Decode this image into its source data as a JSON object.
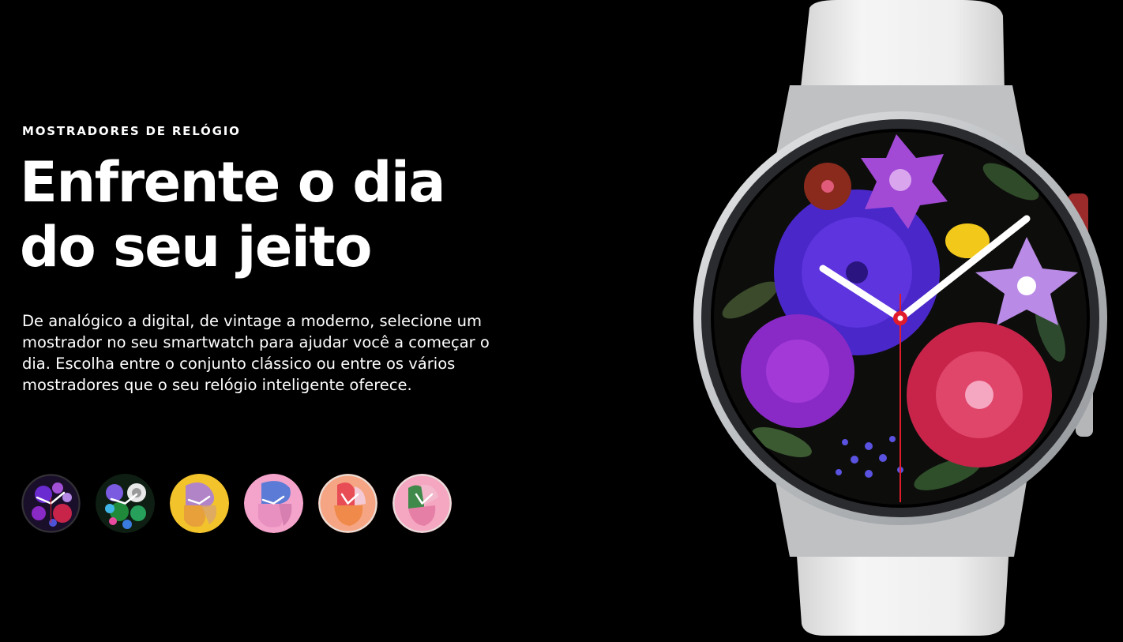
{
  "section": {
    "eyebrow": "MOSTRADORES DE RELÓGIO",
    "headline_line1": "Enfrente o dia",
    "headline_line2": "do seu jeito",
    "description": "De analógico a digital, de vintage a moderno, selecione um mostrador no seu smartwatch para ajudar você a começar o dia. Escolha entre o conjunto clássico ou entre os vários mostradores que o seu relógio inteligente oferece."
  },
  "thumbnails": [
    {
      "icon": "floral-purple-watchface-icon",
      "bg": "#1a0f2a",
      "accent": "#7a2fd0"
    },
    {
      "icon": "floral-green-watchface-icon",
      "bg": "#0e1e12",
      "accent": "#1f8a3a"
    },
    {
      "icon": "yellow-shapes-watchface-icon",
      "bg": "#f3c32c",
      "accent": "#e7a03a"
    },
    {
      "icon": "pink-blue-shapes-watchface-icon",
      "bg": "#f4a3cb",
      "accent": "#5b7bd6"
    },
    {
      "icon": "coral-shapes-watchface-icon",
      "bg": "#f28a6c",
      "accent": "#e84c55"
    },
    {
      "icon": "pink-green-shapes-watchface-icon",
      "bg": "#f5a6c0",
      "accent": "#3f8a4a"
    }
  ],
  "product": {
    "icon": "smartwatch-floral-face-icon",
    "case_color": "#c9cbcd",
    "band_color": "#ededed",
    "hand_color": "#ffffff",
    "second_hand_color": "#e01c2c"
  }
}
